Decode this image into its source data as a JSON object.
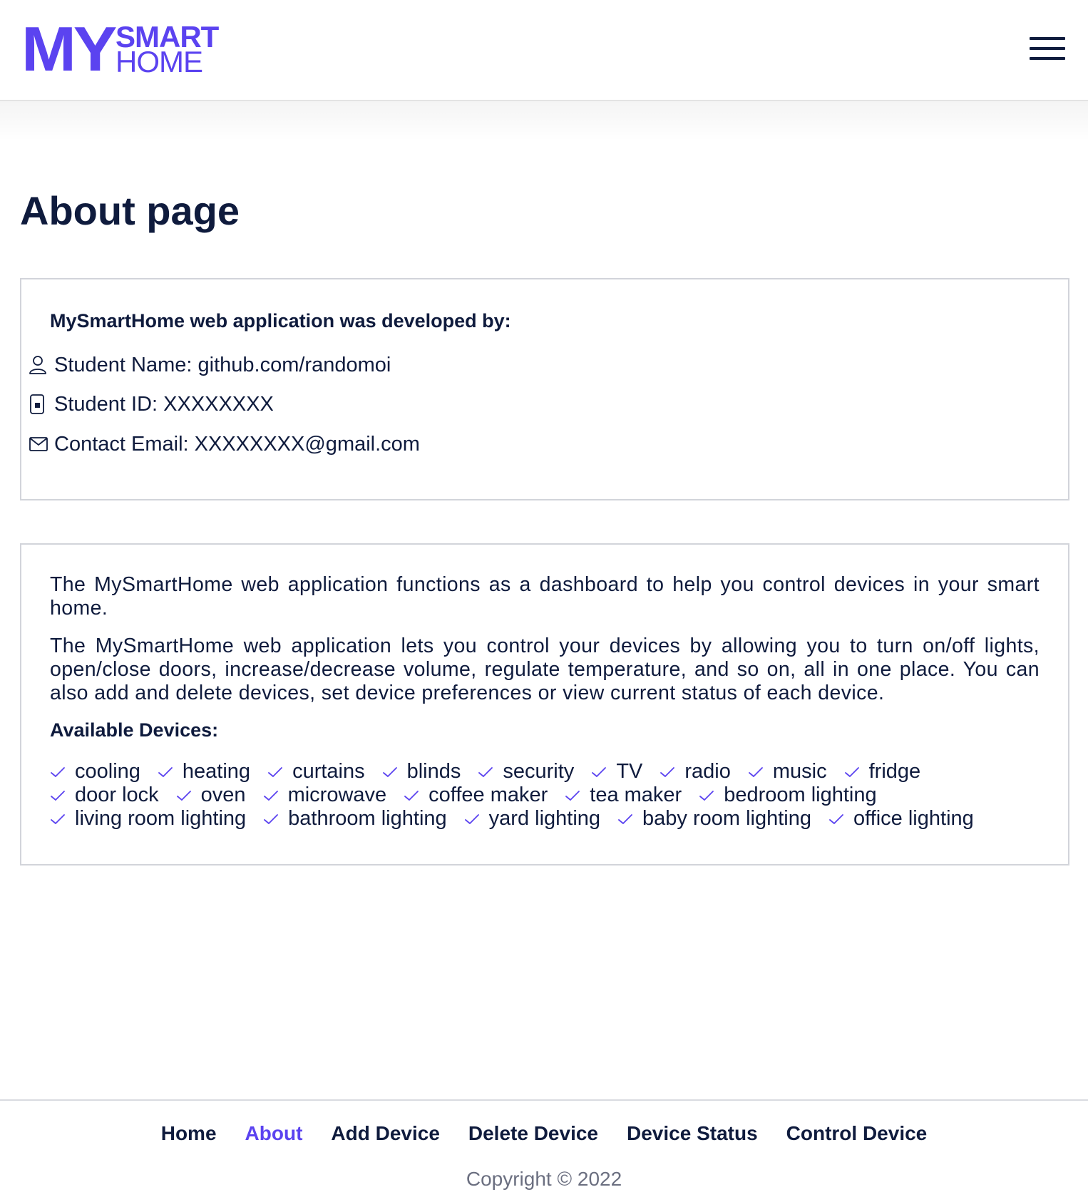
{
  "brand": {
    "logo_my": "MY",
    "logo_smart": "SMART",
    "logo_home": "HOME",
    "accent_color": "#5b43f0",
    "text_color": "#0f1b3d"
  },
  "header": {
    "menu_icon": "hamburger-menu-icon"
  },
  "page": {
    "title": "About page"
  },
  "developer_card": {
    "heading": "MySmartHome web application was developed by:",
    "rows": [
      {
        "icon": "user-icon",
        "text": "Student Name: github.com/randomoi"
      },
      {
        "icon": "id-card-icon",
        "text": "Student ID: XXXXXXXX"
      },
      {
        "icon": "mail-icon",
        "text": "Contact Email: XXXXXXXX@gmail.com"
      }
    ]
  },
  "info_card": {
    "paragraph_1": "The MySmartHome web application functions as a dashboard to help you control devices in your smart home.",
    "paragraph_2": "The MySmartHome web application lets you control your devices by allowing you to turn on/off lights, open/close doors, increase/decrease volume, regulate temperature, and so on, all in one place. You can also add and delete devices, set device preferences or view current status of each device.",
    "devices_heading": "Available Devices:",
    "device_icon": "check-icon",
    "device_lines": [
      [
        "cooling",
        "heating",
        "curtains",
        "blinds",
        "security",
        "TV",
        "radio",
        "music",
        "fridge"
      ],
      [
        "door lock",
        "oven",
        "microwave",
        "coffee maker",
        "tea maker",
        "bedroom lighting"
      ],
      [
        "living room lighting",
        "bathroom lighting",
        "yard lighting",
        "baby room lighting",
        "office lighting"
      ]
    ]
  },
  "footer": {
    "nav": [
      {
        "label": "Home",
        "active": false
      },
      {
        "label": "About",
        "active": true
      },
      {
        "label": "Add Device",
        "active": false
      },
      {
        "label": "Delete Device",
        "active": false
      },
      {
        "label": "Device Status",
        "active": false
      },
      {
        "label": "Control Device",
        "active": false
      }
    ],
    "copyright": "Copyright © 2022"
  }
}
